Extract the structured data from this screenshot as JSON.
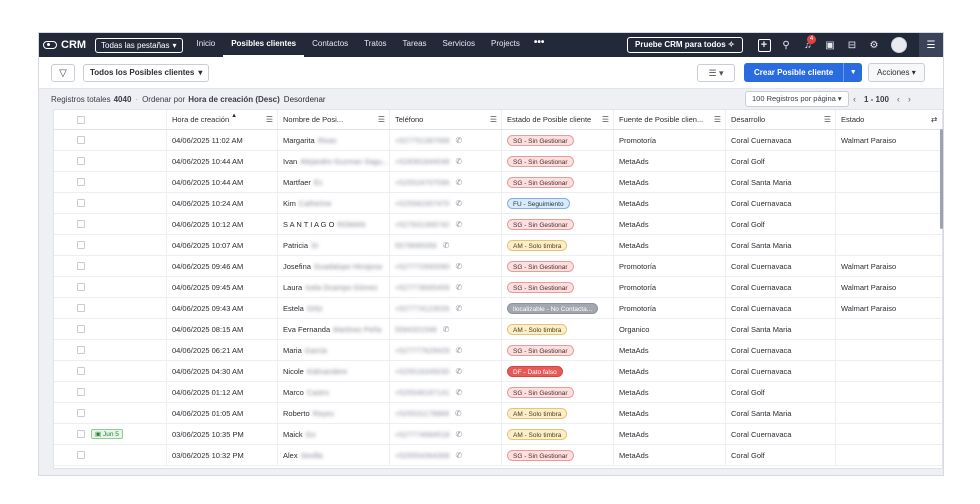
{
  "nav": {
    "logo": "CRM",
    "tabs_dropdown": "Todas las pestañas",
    "links": [
      "Inicio",
      "Posibles clientes",
      "Contactos",
      "Tratos",
      "Tareas",
      "Servicios",
      "Projects"
    ],
    "more": "•••",
    "trial_button": "Pruebe CRM para todos",
    "notification_count": "4"
  },
  "toolbar": {
    "view_name": "Todos los Posibles clientes",
    "create_button": "Crear Posible cliente",
    "actions_button": "Acciones"
  },
  "info": {
    "total_label": "Registros totales",
    "total_value": "4040",
    "sort_prefix": "Ordenar por",
    "sort_value": "Hora de creación (Desc)",
    "unsort": "Desordenar",
    "per_page": "100 Registros por página",
    "range": "1 - 100"
  },
  "table": {
    "columns": [
      "Hora de creación",
      "Nombre de Posi...",
      "Teléfono",
      "Estado de Posible cliente",
      "Fuente de Posible clien...",
      "Desarrollo",
      "Estado"
    ],
    "rows": [
      {
        "tag": "",
        "time": "04/06/2025 11:02 AM",
        "first": "Margarita",
        "last": "Rivas",
        "phone": "+527751387068",
        "status": "SG - Sin Gestionar",
        "status_type": "sg",
        "source": "Promotoría",
        "dev": "Coral Cuernavaca",
        "estado": "Walmart Paraiso"
      },
      {
        "tag": "",
        "time": "04/06/2025 10:44 AM",
        "first": "Ivan",
        "last": "Alejandro Guzman Sagu...",
        "phone": "+528381844048",
        "status": "SG - Sin Gestionar",
        "status_type": "sg",
        "source": "MetaAds",
        "dev": "Coral Golf",
        "estado": ""
      },
      {
        "tag": "",
        "time": "04/06/2025 10:44 AM",
        "first": "Martfaer",
        "last": "Ec",
        "phone": "+525524707096",
        "status": "SG - Sin Gestionar",
        "status_type": "sg",
        "source": "MetaAds",
        "dev": "Coral Santa Maria",
        "estado": ""
      },
      {
        "tag": "",
        "time": "04/06/2025 10:24 AM",
        "first": "Kim",
        "last": "Catherine",
        "phone": "+525582357470",
        "status": "FU - Seguimiento",
        "status_type": "fu",
        "source": "MetaAds",
        "dev": "Coral Cuernavaca",
        "estado": ""
      },
      {
        "tag": "",
        "time": "04/06/2025 10:12 AM",
        "first": "S A N T I A G O",
        "last": "ROMAN",
        "phone": "+527831368742",
        "status": "SG - Sin Gestionar",
        "status_type": "sg",
        "source": "MetaAds",
        "dev": "Coral Golf",
        "estado": ""
      },
      {
        "tag": "",
        "time": "04/06/2025 10:07 AM",
        "first": "Patricia",
        "last": "Sr",
        "phone": "5579685056",
        "status": "AM - Solo timbra",
        "status_type": "am",
        "source": "MetaAds",
        "dev": "Coral Santa Maria",
        "estado": ""
      },
      {
        "tag": "",
        "time": "04/06/2025 09:46 AM",
        "first": "Josefina",
        "last": "Guadalupe Hinojosa",
        "phone": "+527772660090",
        "status": "SG - Sin Gestionar",
        "status_type": "sg",
        "source": "Promotoría",
        "dev": "Coral Cuernavaca",
        "estado": "Walmart Paraiso"
      },
      {
        "tag": "",
        "time": "04/06/2025 09:45 AM",
        "first": "Laura",
        "last": "Isela Ocampo Gómez",
        "phone": "+527778665459",
        "status": "SG - Sin Gestionar",
        "status_type": "sg",
        "source": "Promotoría",
        "dev": "Coral Cuernavaca",
        "estado": "Walmart Paraiso"
      },
      {
        "tag": "",
        "time": "04/06/2025 09:43 AM",
        "first": "Estela",
        "last": "Ortiz",
        "phone": "+527774123026",
        "status": "llocalizable - No Contacta...",
        "status_type": "loc",
        "source": "Promotoría",
        "dev": "Coral Cuernavaca",
        "estado": "Walmart Paraiso"
      },
      {
        "tag": "",
        "time": "04/06/2025 08:15 AM",
        "first": "Eva Fernanda",
        "last": "Martinez Peña",
        "phone": "5584301548",
        "status": "AM - Solo timbra",
        "status_type": "am",
        "source": "Organico",
        "dev": "Coral Santa Maria",
        "estado": ""
      },
      {
        "tag": "",
        "time": "04/06/2025 06:21 AM",
        "first": "Maria",
        "last": "Garcia",
        "phone": "+527777629429",
        "status": "SG - Sin Gestionar",
        "status_type": "sg",
        "source": "MetaAds",
        "dev": "Coral Cuernavaca",
        "estado": ""
      },
      {
        "tag": "",
        "time": "04/06/2025 04:30 AM",
        "first": "Nicole",
        "last": "Kidmandere",
        "phone": "+525516345030",
        "status": "DF - Dato falso",
        "status_type": "df",
        "source": "MetaAds",
        "dev": "Coral Cuernavaca",
        "estado": ""
      },
      {
        "tag": "",
        "time": "04/06/2025 01:12 AM",
        "first": "Marco",
        "last": "Castro",
        "phone": "+525548187141",
        "status": "SG - Sin Gestionar",
        "status_type": "sg",
        "source": "MetaAds",
        "dev": "Coral Golf",
        "estado": ""
      },
      {
        "tag": "",
        "time": "04/06/2025 01:05 AM",
        "first": "Roberto",
        "last": "Reyes",
        "phone": "+525531178868",
        "status": "AM - Solo timbra",
        "status_type": "am",
        "source": "MetaAds",
        "dev": "Coral Santa Maria",
        "estado": ""
      },
      {
        "tag": "Jun 5",
        "time": "03/06/2025 10:35 PM",
        "first": "Maick",
        "last": "Go",
        "phone": "+527774984518",
        "status": "AM - Solo timbra",
        "status_type": "am",
        "source": "MetaAds",
        "dev": "Coral Cuernavaca",
        "estado": ""
      },
      {
        "tag": "",
        "time": "03/06/2025 10:32 PM",
        "first": "Alex",
        "last": "Sevilla",
        "phone": "+525554364368",
        "status": "SG - Sin Gestionar",
        "status_type": "sg",
        "source": "MetaAds",
        "dev": "Coral Golf",
        "estado": ""
      }
    ]
  }
}
